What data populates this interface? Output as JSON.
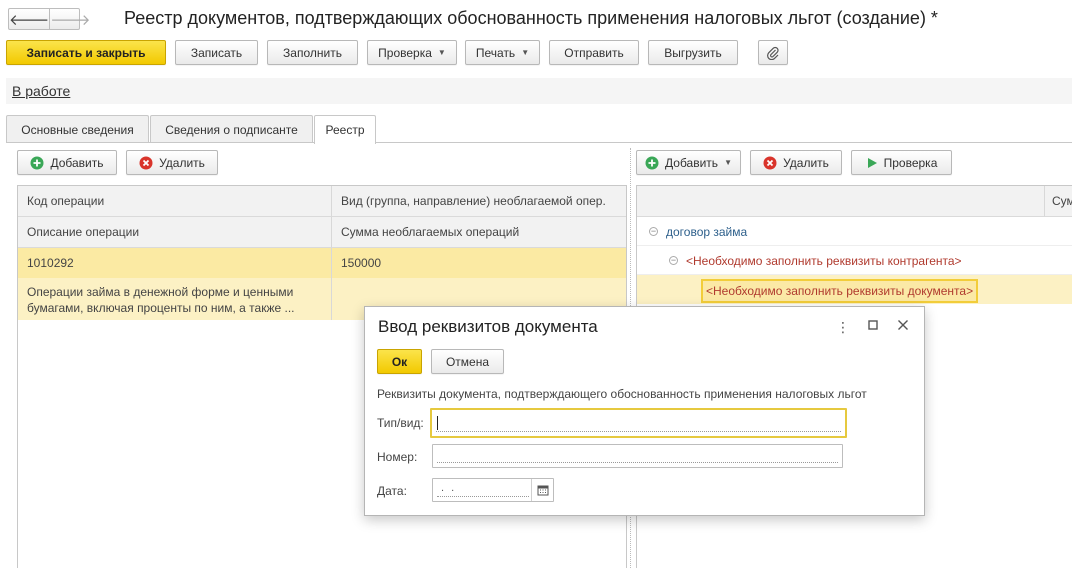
{
  "window": {
    "title": "Реестр документов, подтверждающих обоснованность применения налоговых льгот (создание) *",
    "back_glyph": "🡐",
    "forward_glyph": "🡒"
  },
  "toolbar": {
    "save_close": "Записать и закрыть",
    "save": "Записать",
    "fill": "Заполнить",
    "check": "Проверка",
    "print": "Печать",
    "send": "Отправить",
    "export": "Выгрузить"
  },
  "status": {
    "link": "В работе"
  },
  "tabs": [
    "Основные сведения",
    "Сведения о подписанте",
    "Реестр"
  ],
  "left_panel": {
    "add": "Добавить",
    "delete": "Удалить",
    "headers": {
      "op_code": "Код операции",
      "op_type": "Вид (группа, направление) необлагаемой опер.",
      "op_desc": "Описание операции",
      "op_sum": "Сумма необлагаемых операций"
    },
    "row": {
      "code": "1010292",
      "sum": "150000",
      "description": "Операции займа в денежной форме и ценными бумагами, включая проценты по ним, а также ..."
    }
  },
  "right_panel": {
    "add": "Добавить",
    "delete": "Удалить",
    "check": "Проверка",
    "col_header": "Сумм",
    "tree": {
      "root": "договор займа",
      "child": "<Необходимо заполнить реквизиты контрагента>",
      "leaf": "<Необходимо заполнить реквизиты документа>"
    }
  },
  "modal": {
    "title": "Ввод реквизитов документа",
    "ok": "Ок",
    "cancel": "Отмена",
    "description": "Реквизиты документа, подтверждающего обоснованность применения налоговых льгот",
    "type_label": "Тип/вид:",
    "type_value": "",
    "number_label": "Номер:",
    "number_value": "",
    "date_label": "Дата:",
    "date_value": " .  ."
  },
  "colors": {
    "accent_yellow": "#f5d21b",
    "selection": "#fbeaa3",
    "tree_root": "#2d5f8b",
    "tree_warning": "#b03a2e",
    "add_icon": "#3aa757",
    "delete_icon": "#d9342b",
    "check_icon": "#3aa757"
  }
}
